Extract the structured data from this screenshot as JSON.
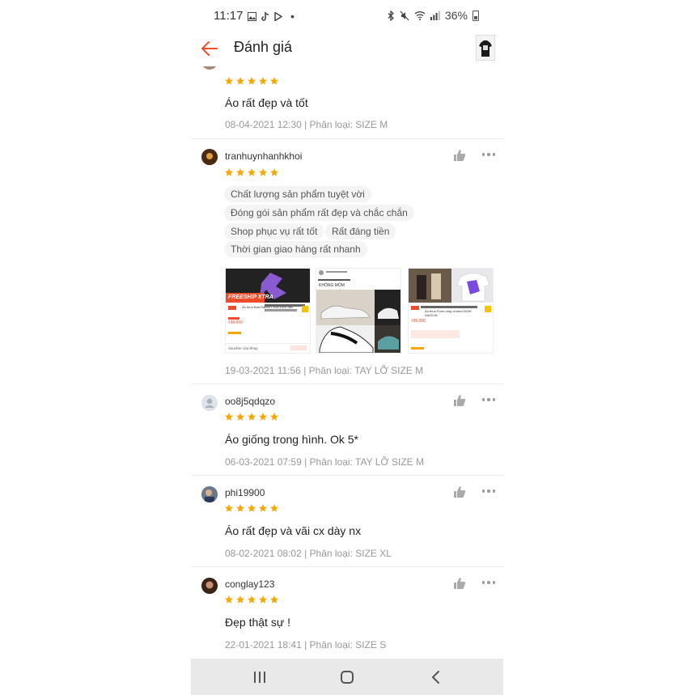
{
  "status_bar": {
    "time": "11:17",
    "dot": "•",
    "battery": "36%",
    "left_icons": [
      "gallery-icon",
      "tiktok-icon",
      "play-store-icon"
    ],
    "right_icons": [
      "bluetooth-icon",
      "mute-icon",
      "wifi-icon",
      "signal-icon",
      "battery-icon"
    ]
  },
  "header": {
    "title": "Đánh giá",
    "back_icon": "back-arrow-icon",
    "accent": "#ee4d2d"
  },
  "colors": {
    "star": "#f6a700",
    "meta": "#999999"
  },
  "reviews": [
    {
      "username": "",
      "rating": 5,
      "comment": "Áo rất đẹp và tốt",
      "meta": "08-04-2021 12:30 | Phân loại: SIZE M"
    },
    {
      "username": "tranhuynhanhkhoi",
      "rating": 5,
      "tags": [
        "Chất lượng sản phẩm tuyệt vời",
        "Đóng gói sản phẩm rất đẹp và chắc chắn",
        "Shop phục vụ rất tốt",
        "Rất đáng tiền",
        "Thời gian giao hàng rất nhanh"
      ],
      "photos": [
        {
          "banner": "FREESHIP XTRA",
          "product": "Áo thun Bad Rabbit CRACKEN đen",
          "price": "₫99.000",
          "footer": "Voucher của Shop"
        },
        {
          "caption": "KHÔNG MÓM"
        },
        {
          "product": "Áo thun Form rộng Unisex NOW SAIGON",
          "price": "₫89.000"
        }
      ],
      "meta": "19-03-2021 11:56 | Phân loại: TAY LỠ SIZE M"
    },
    {
      "username": "oo8j5qdqzo",
      "rating": 5,
      "comment": "Áo giống trong hình. Ok 5*",
      "meta": "06-03-2021 07:59 | Phân loại: TAY LỠ SIZE M"
    },
    {
      "username": "phi19900",
      "rating": 5,
      "comment": "Áo rất đẹp và vãi cx dày nx",
      "meta": "08-02-2021 08:02 | Phân loại: SIZE XL"
    },
    {
      "username": "conglay123",
      "rating": 5,
      "comment": "Đẹp thật sự !",
      "meta": "22-01-2021 18:41 | Phân loại: SIZE S"
    }
  ],
  "nav_bar": {
    "recent_icon": "recent-apps-icon",
    "home_icon": "home-icon",
    "back_icon": "nav-back-icon"
  }
}
